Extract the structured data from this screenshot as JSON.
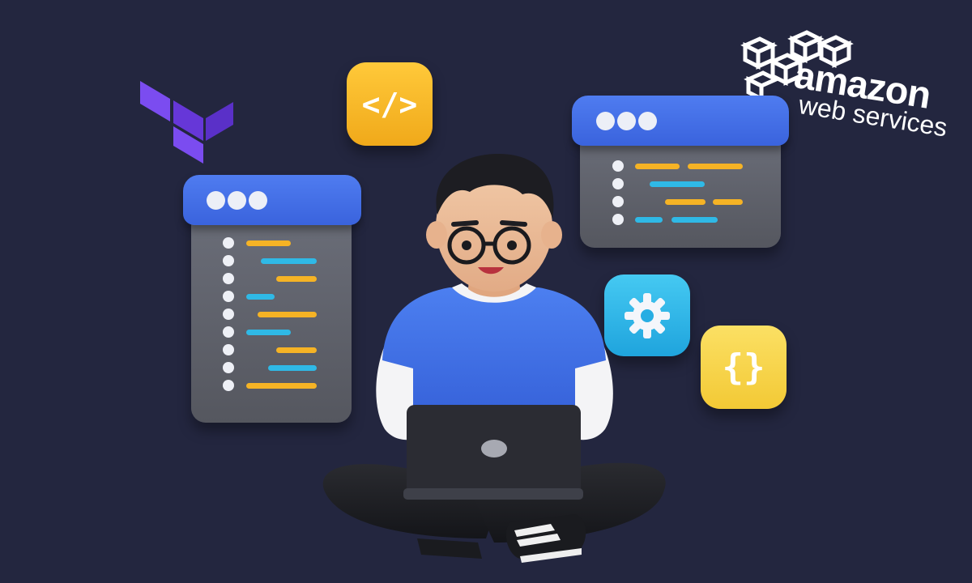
{
  "scene": "developer-illustration",
  "colors": {
    "background": "#23263f",
    "window_bar": "#3a63dd",
    "code_yellow": "#f5b325",
    "code_cyan": "#2fb9e6",
    "tile_yellow": "#f6b724",
    "tile_cyan": "#29b5e8",
    "tile_lightyellow": "#f7d64a",
    "terraform_purple": "#6d3de6",
    "shirt": "#3f6fe3"
  },
  "tiles": {
    "code_tag": "</>",
    "gear_icon": "gear-icon",
    "braces": "{}"
  },
  "aws_logo": {
    "line1": "amazon",
    "line2": "web services"
  },
  "terraform_logo": "terraform-icon"
}
